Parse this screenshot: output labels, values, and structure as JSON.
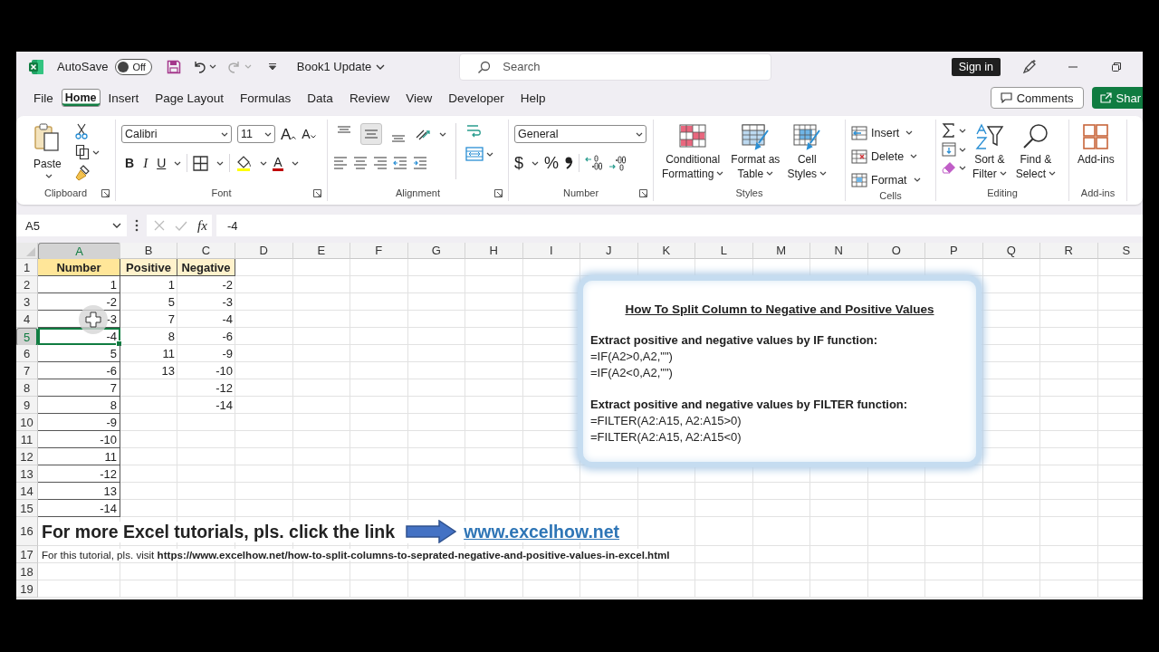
{
  "title_bar": {
    "autosave_label": "AutoSave",
    "autosave_toggle": {
      "label": "Off",
      "on": false
    },
    "document_title": "Book1 Update",
    "search": {
      "placeholder": "Search"
    },
    "sign_in": "Sign in"
  },
  "menu": {
    "tabs": [
      {
        "label": "File",
        "selected": false
      },
      {
        "label": "Home",
        "selected": true
      },
      {
        "label": "Insert",
        "selected": false
      },
      {
        "label": "Page Layout",
        "selected": false
      },
      {
        "label": "Formulas",
        "selected": false
      },
      {
        "label": "Data",
        "selected": false
      },
      {
        "label": "Review",
        "selected": false
      },
      {
        "label": "View",
        "selected": false
      },
      {
        "label": "Developer",
        "selected": false
      },
      {
        "label": "Help",
        "selected": false
      }
    ],
    "comments_button": "Comments",
    "share_button": "Shar"
  },
  "ribbon": {
    "clipboard": {
      "label": "Clipboard",
      "paste": "Paste"
    },
    "font": {
      "label": "Font",
      "font_name": "Calibri",
      "font_size": "11",
      "grow": "A",
      "shrink": "A",
      "bold": "B",
      "italic": "I",
      "underline": "U",
      "font_color": "A"
    },
    "alignment": {
      "label": "Alignment",
      "vertical": [
        {
          "kind": "top",
          "selected": false
        },
        {
          "kind": "middle",
          "selected": true
        },
        {
          "kind": "bottom",
          "selected": false
        }
      ]
    },
    "number": {
      "label": "Number",
      "format": "General",
      "currency": "$",
      "percent": "%"
    },
    "styles": {
      "label": "Styles",
      "buttons": [
        {
          "kind": "conditional",
          "lines": [
            "Conditional",
            "Formatting"
          ]
        },
        {
          "kind": "table",
          "lines": [
            "Format as",
            "Table"
          ]
        },
        {
          "kind": "cell",
          "lines": [
            "Cell",
            "Styles"
          ]
        }
      ]
    },
    "cells": {
      "label": "Cells",
      "buttons": [
        {
          "kind": "insert",
          "label": "Insert"
        },
        {
          "kind": "delete",
          "label": "Delete"
        },
        {
          "kind": "format",
          "label": "Format"
        }
      ]
    },
    "editing": {
      "label": "Editing",
      "buttons": [
        {
          "kind": "sort",
          "lines": [
            "Sort &",
            "Filter"
          ]
        },
        {
          "kind": "find",
          "lines": [
            "Find &",
            "Select"
          ]
        }
      ]
    },
    "add_ins": {
      "label": "Add-ins",
      "button": "Add-ins"
    }
  },
  "formula_bar": {
    "name_box": "A5",
    "function_label": "fx",
    "value": "-4"
  },
  "sheet": {
    "columns": [
      {
        "label": "A",
        "selected": true
      },
      {
        "label": "B",
        "selected": false
      },
      {
        "label": "C",
        "selected": false
      },
      {
        "label": "D",
        "selected": false
      },
      {
        "label": "E",
        "selected": false
      },
      {
        "label": "F",
        "selected": false
      },
      {
        "label": "G",
        "selected": false
      },
      {
        "label": "H",
        "selected": false
      },
      {
        "label": "I",
        "selected": false
      },
      {
        "label": "J",
        "selected": false
      },
      {
        "label": "K",
        "selected": false
      },
      {
        "label": "L",
        "selected": false
      },
      {
        "label": "M",
        "selected": false
      },
      {
        "label": "N",
        "selected": false
      },
      {
        "label": "O",
        "selected": false
      },
      {
        "label": "P",
        "selected": false
      },
      {
        "label": "Q",
        "selected": false
      },
      {
        "label": "R",
        "selected": false
      },
      {
        "label": "S",
        "selected": false
      }
    ],
    "rows": [
      {
        "number": "1",
        "kind": "header",
        "selected": false,
        "cells": [
          {
            "text": "Number",
            "color": "#ffe699"
          },
          {
            "text": "Positive",
            "color": "#fff2cc"
          },
          {
            "text": "Negative",
            "color": "#fff2cc"
          }
        ]
      },
      {
        "number": "2",
        "kind": "data",
        "selected": false,
        "cells": [
          "1",
          "1",
          "-2"
        ]
      },
      {
        "number": "3",
        "kind": "data",
        "selected": false,
        "cells": [
          "-2",
          "5",
          "-3"
        ]
      },
      {
        "number": "4",
        "kind": "data",
        "selected": false,
        "cells": [
          "-3",
          "7",
          "-4"
        ]
      },
      {
        "number": "5",
        "kind": "data",
        "selected": true,
        "cells": [
          "-4",
          "8",
          "-6"
        ]
      },
      {
        "number": "6",
        "kind": "data",
        "selected": false,
        "cells": [
          "5",
          "11",
          "-9"
        ]
      },
      {
        "number": "7",
        "kind": "data",
        "selected": false,
        "cells": [
          "-6",
          "13",
          "-10"
        ]
      },
      {
        "number": "8",
        "kind": "data",
        "selected": false,
        "cells": [
          "7",
          null,
          "-12"
        ]
      },
      {
        "number": "9",
        "kind": "data",
        "selected": false,
        "cells": [
          "8",
          null,
          "-14"
        ]
      },
      {
        "number": "10",
        "kind": "data",
        "selected": false,
        "cells": [
          "-9"
        ]
      },
      {
        "number": "11",
        "kind": "data",
        "selected": false,
        "cells": [
          "-10"
        ]
      },
      {
        "number": "12",
        "kind": "data",
        "selected": false,
        "cells": [
          "11"
        ]
      },
      {
        "number": "13",
        "kind": "data",
        "selected": false,
        "cells": [
          "-12"
        ]
      },
      {
        "number": "14",
        "kind": "data",
        "selected": false,
        "cells": [
          "13"
        ]
      },
      {
        "number": "15",
        "kind": "data",
        "selected": false,
        "cells": [
          "-14"
        ]
      },
      {
        "number": "16",
        "kind": "banner",
        "selected": false,
        "text": "For more Excel tutorials, pls. click the link",
        "link": "www.excelhow.net"
      },
      {
        "number": "17",
        "kind": "note",
        "selected": false,
        "text": "For this tutorial, pls. visit **https://www.excelhow.net/how-to-split-columns-to-seprated-negative-and-positive-values-in-excel.html**"
      },
      {
        "number": "18",
        "kind": "empty",
        "selected": false
      },
      {
        "number": "19",
        "kind": "empty",
        "selected": false
      }
    ]
  },
  "text_box": {
    "title": "How To Split Column to Negative and Positive Values",
    "sections": [
      {
        "heading": "Extract positive and negative values by IF function:",
        "formulas": [
          "=IF(A2>0,A2,\"\")",
          "=IF(A2<0,A2,\"\")"
        ]
      },
      {
        "heading": "Extract positive and negative values by FILTER function:",
        "formulas": [
          "=FILTER(A2:A15, A2:A15>0)",
          "=FILTER(A2:A15, A2:A15<0)"
        ]
      }
    ]
  }
}
